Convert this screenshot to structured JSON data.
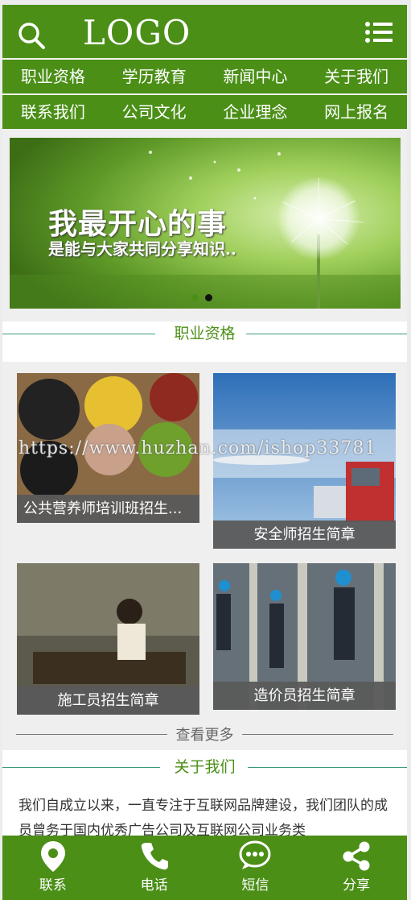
{
  "header": {
    "logo": "LOGO"
  },
  "nav_rows": [
    [
      "职业资格",
      "学历教育",
      "新闻中心",
      "关于我们"
    ],
    [
      "联系我们",
      "公司文化",
      "企业理念",
      "网上报名"
    ]
  ],
  "banner": {
    "headline": "我最开心的事",
    "subline": "是能与大家共同分享知识..",
    "active_dot": 1,
    "dot_count": 2
  },
  "section_qualifications": {
    "title": "职业资格",
    "cards": [
      {
        "caption": "公共营养师培训班招生..."
      },
      {
        "caption": "安全师招生简章"
      },
      {
        "caption": "施工员招生简章"
      },
      {
        "caption": "造价员招生简章"
      }
    ],
    "more": "查看更多"
  },
  "watermark": "https://www.huzhan.com/ishop33781",
  "section_about": {
    "title": "关于我们",
    "text": "我们自成立以来，一直专注于互联网品牌建设，我们团队的成员曾务于国内优秀广告公司及互联网公司业务类"
  },
  "footer": {
    "items": [
      {
        "label": "联系",
        "icon": "location-pin-icon"
      },
      {
        "label": "电话",
        "icon": "phone-icon"
      },
      {
        "label": "短信",
        "icon": "message-icon"
      },
      {
        "label": "分享",
        "icon": "share-icon"
      }
    ]
  },
  "colors": {
    "brand_green": "#4b8f17",
    "divider_teal": "#3a9b7a"
  }
}
